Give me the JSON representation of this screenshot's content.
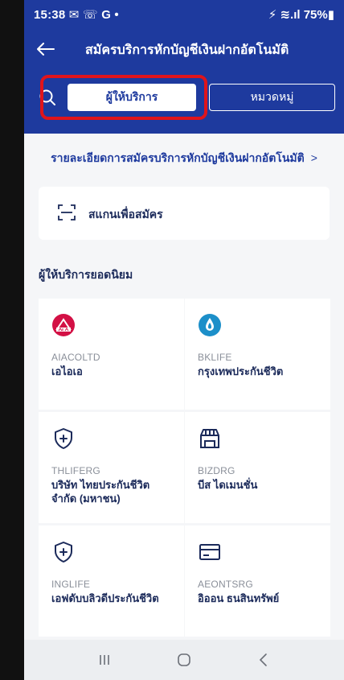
{
  "status_bar": {
    "time": "15:38 ✉ ☏ G •",
    "right": "⚡ ≋.ıl 75%▮"
  },
  "app_bar": {
    "title": "สมัครบริการหักบัญชีเงินฝากอัตโนมัติ"
  },
  "tabs": {
    "active": "ผู้ให้บริการ",
    "inactive": "หมวดหมู่"
  },
  "details_link": {
    "label": "รายละเอียดการสมัครบริการหักบัญชีเงินฝากอัตโนมัติ",
    "chevron": ">"
  },
  "scan": {
    "label": "สแกนเพื่อสมัคร"
  },
  "popular": {
    "title": "ผู้ให้บริการยอดนิยม",
    "providers": [
      {
        "code": "AIACOLTD",
        "name": "เอไอเอ",
        "icon": "aia-logo-icon"
      },
      {
        "code": "BKLIFE",
        "name": "กรุงเทพประกันชีวิต",
        "icon": "bklife-logo-icon"
      },
      {
        "code": "THLIFERG",
        "name": "บริษัท ไทยประกันชีวิต จำกัด (มหาชน)",
        "icon": "shield-plus-icon"
      },
      {
        "code": "BIZDRG",
        "name": "บีส ไดเมนชั่น",
        "icon": "store-icon"
      },
      {
        "code": "INGLIFE",
        "name": "เอฟดับบลิวดีประกันชีวิต",
        "icon": "shield-plus-icon"
      },
      {
        "code": "AEONTSRG",
        "name": "อิออน ธนสินทรัพย์",
        "icon": "card-icon"
      }
    ]
  },
  "colors": {
    "brand": "#1e3a9e",
    "highlight": "#e0141b"
  }
}
